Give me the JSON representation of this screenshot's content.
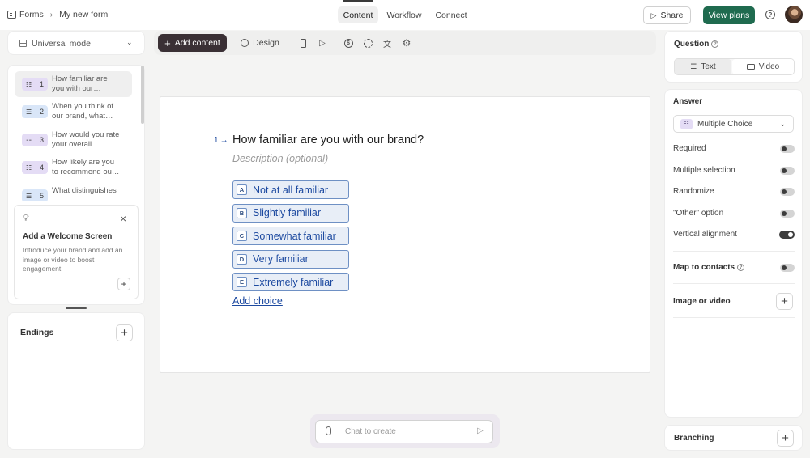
{
  "breadcrumb": {
    "root": "Forms",
    "current": "My new form"
  },
  "nav_tabs": [
    "Content",
    "Workflow",
    "Connect"
  ],
  "header": {
    "share": "Share",
    "view_plans": "View plans",
    "help": "?"
  },
  "mode_select": {
    "label": "Universal mode"
  },
  "toolbar": {
    "add_content": "Add content",
    "design": "Design"
  },
  "questions": [
    {
      "num": "1",
      "text": "How familiar are you with our…",
      "type": "choice",
      "color": "#e4dcf5"
    },
    {
      "num": "2",
      "text": "When you think of our brand, what…",
      "type": "text",
      "color": "#d9e6f8"
    },
    {
      "num": "3",
      "text": "How would you rate your overall…",
      "type": "choice",
      "color": "#e4dcf5"
    },
    {
      "num": "4",
      "text": "How likely are you to recommend ou…",
      "type": "choice",
      "color": "#e4dcf5"
    },
    {
      "num": "5",
      "text": "What distinguishes",
      "type": "text",
      "color": "#d9e6f8"
    }
  ],
  "welcome": {
    "title": "Add a Welcome Screen",
    "body": "Introduce your brand and add an image or video to boost engagement."
  },
  "endings": {
    "label": "Endings"
  },
  "editor": {
    "number": "1",
    "question": "How familiar are you with our brand?",
    "description_placeholder": "Description (optional)",
    "choices": [
      {
        "key": "A",
        "label": "Not at all familiar"
      },
      {
        "key": "B",
        "label": "Slightly familiar"
      },
      {
        "key": "C",
        "label": "Somewhat familiar"
      },
      {
        "key": "D",
        "label": "Very familiar"
      },
      {
        "key": "E",
        "label": "Extremely familiar"
      }
    ],
    "add_choice": "Add choice"
  },
  "chat": {
    "placeholder": "Chat to create"
  },
  "right_panel": {
    "question_label": "Question",
    "seg_text": "Text",
    "seg_video": "Video",
    "answer_label": "Answer",
    "answer_type": "Multiple Choice",
    "settings": [
      {
        "label": "Required",
        "on": false
      },
      {
        "label": "Multiple selection",
        "on": false
      },
      {
        "label": "Randomize",
        "on": false
      },
      {
        "label": "\"Other\" option",
        "on": false
      },
      {
        "label": "Vertical alignment",
        "on": true
      }
    ],
    "map_contacts": "Map to contacts",
    "image_video": "Image or video",
    "branching": "Branching"
  },
  "colors": {
    "accent_green": "#1f6b4f",
    "dark_button": "#3a3035",
    "choice_blue": "#1d4aa0"
  }
}
